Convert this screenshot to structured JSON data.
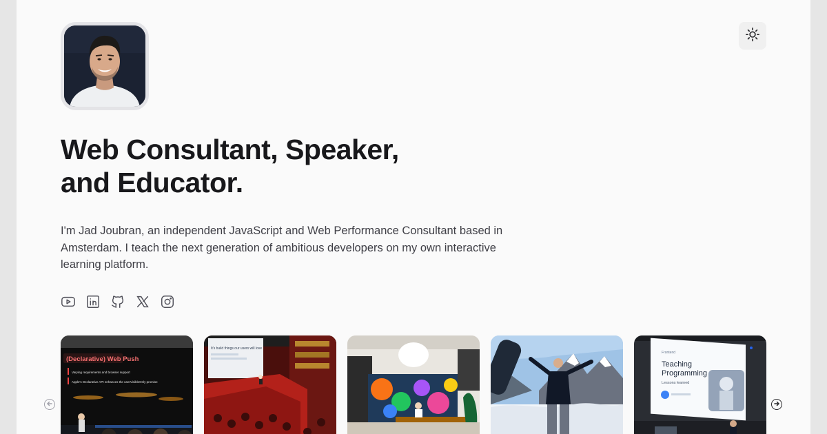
{
  "header": {
    "headline_line1": "Web Consultant, Speaker,",
    "headline_line2": "and Educator.",
    "theme_toggle_icon": "sun-icon"
  },
  "bio": {
    "line1": "I'm Jad Joubran, an independent JavaScript and Web Performance Consultant based in",
    "line2": "Amsterdam. I teach the next generation of ambitious developers on my own interactive",
    "line3": "learning platform."
  },
  "socials": [
    "youtube-icon",
    "linkedin-icon",
    "github-icon",
    "x-icon",
    "instagram-icon"
  ],
  "gallery": {
    "photo1": {
      "title": "(Declarative) Web Push",
      "bullet1": "Varying requirements and browser support",
      "bullet2": "Apple's Declarative API enhances the userVisibleOnly promise"
    },
    "photo2": {
      "slide_text": "It's build things our users will love"
    },
    "photo3": {},
    "photo4": {},
    "photo5": {
      "brand": "Frontend",
      "title_line1": "Teaching",
      "title_line2": "Programming",
      "subtitle": "Lessons learned"
    }
  },
  "colors": {
    "background": "#fafafa",
    "outer": "#e6e6e6",
    "heading": "#18181b",
    "body_text": "#3f3f46",
    "accent_red": "#ef4444"
  }
}
